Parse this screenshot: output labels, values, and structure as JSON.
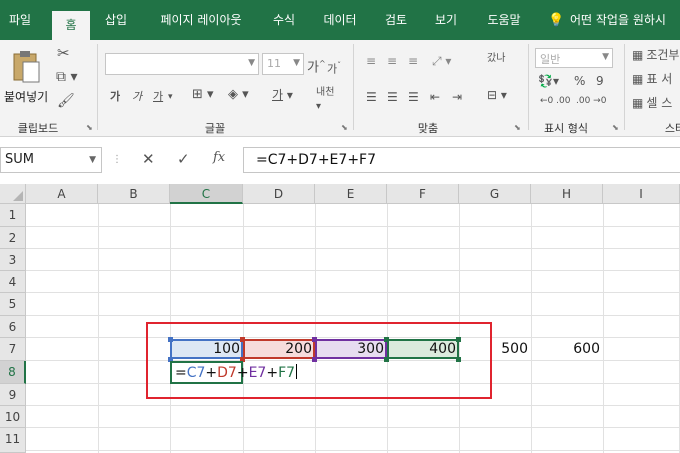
{
  "ribbon": {
    "tabs": [
      "파일",
      "홈",
      "삽입",
      "페이지 레이아웃",
      "수식",
      "데이터",
      "검토",
      "보기",
      "도움말"
    ],
    "active_tab": "홈",
    "tell_me": "어떤 작업을 원하시",
    "clipboard": {
      "paste": "붙여넣기",
      "label": "클립보드"
    },
    "font": {
      "label": "글꼴",
      "size": "11",
      "grow": "가",
      "shrink": "가",
      "bold": "가",
      "italic": "가",
      "underline": "가",
      "color_letter": "가",
      "phonetic": "내천"
    },
    "alignment": {
      "label": "맞춤",
      "wrap": "갔나"
    },
    "number": {
      "label": "표시 형식",
      "format": "일반",
      "percent": "%",
      "comma": "9"
    },
    "styles": {
      "label": "스타",
      "conditional": "조건부",
      "table": "표 서",
      "cell": "셀 스"
    }
  },
  "formula_bar": {
    "name_box": "SUM",
    "cancel": "✕",
    "enter": "✓",
    "fx": "fx",
    "content": "=C7+D7+E7+F7"
  },
  "sheet": {
    "columns": [
      "A",
      "B",
      "C",
      "D",
      "E",
      "F",
      "G",
      "H",
      "I"
    ],
    "rows": [
      "1",
      "2",
      "3",
      "4",
      "5",
      "6",
      "7",
      "8",
      "9",
      "10",
      "11"
    ],
    "selected_column": "C",
    "selected_row": "8",
    "cells": {
      "C7": "100",
      "D7": "200",
      "E7": "300",
      "F7": "400",
      "G7": "500",
      "H7": "600"
    },
    "editing_cell": "C8",
    "formula_parts": [
      "=",
      "C7",
      "+",
      "D7",
      "+",
      "E7",
      "+",
      "F7"
    ]
  },
  "colors": {
    "accent": "#217346",
    "ref_c": "#4472c4",
    "ref_d": "#c0392b",
    "ref_e": "#7030a0",
    "ref_f": "#217346",
    "highlight": "#e0242f"
  }
}
